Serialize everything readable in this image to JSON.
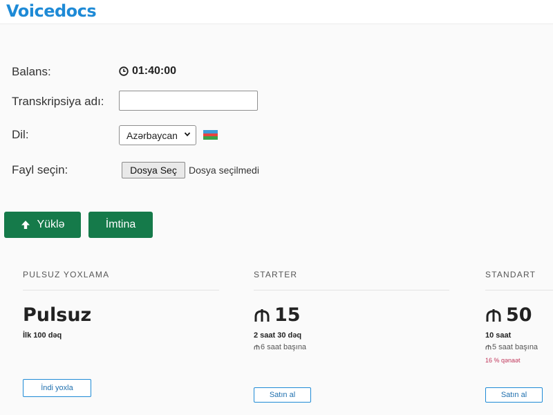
{
  "app": {
    "logo": "Voicedocs"
  },
  "form": {
    "balance_label": "Balans:",
    "balance_value": "01:40:00",
    "name_label": "Transkripsiya adı:",
    "name_value": "",
    "language_label": "Dil:",
    "language_selected": "Azərbaycan",
    "file_label": "Fayl seçin:",
    "file_button": "Dosya Seç",
    "file_status": "Dosya seçilmedi"
  },
  "actions": {
    "upload": "Yüklə",
    "cancel": "İmtina"
  },
  "colors": {
    "brand": "#1e8ad6",
    "primary_button": "#157a4a",
    "savings": "#c0355a"
  },
  "plans": [
    {
      "name": "PULSUZ YOXLAMA",
      "price": "Pulsuz",
      "subtitle": "İlk 100 dəq",
      "rate": "",
      "savings": "",
      "button": "İndi yoxla"
    },
    {
      "name": "STARTER",
      "price": "15",
      "subtitle": "2 saat 30 dəq",
      "rate": "6 saat başına",
      "savings": "",
      "button": "Satın al"
    },
    {
      "name": "STANDART",
      "price": "50",
      "subtitle": "10 saat",
      "rate": "5 saat başına",
      "savings": "16 % qənaət",
      "button": "Satın al"
    }
  ]
}
